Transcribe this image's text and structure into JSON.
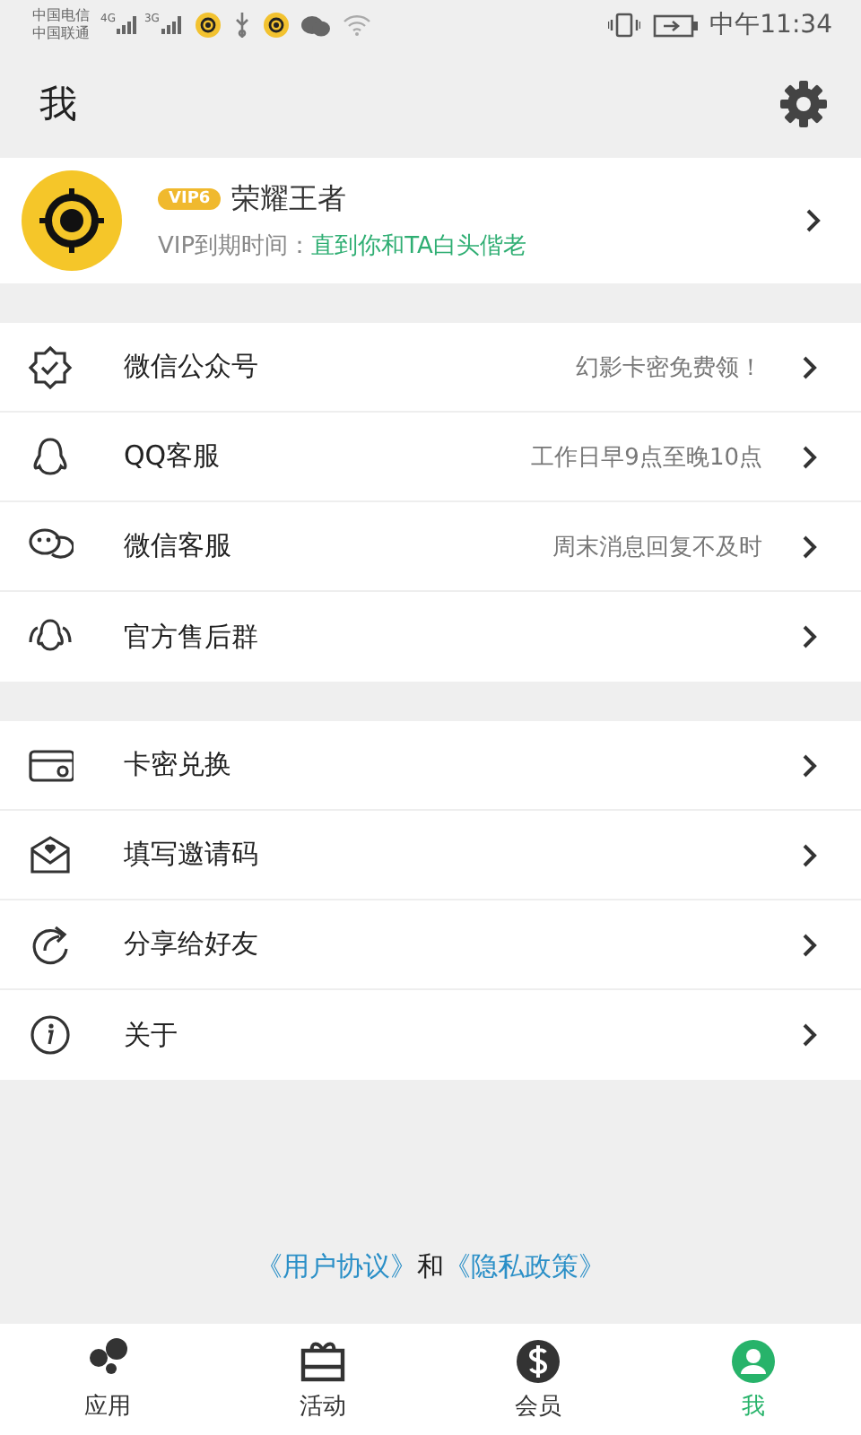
{
  "status_bar": {
    "carriers": [
      "中国电信",
      "中国联通"
    ],
    "networks": [
      "4G",
      "3G"
    ],
    "time": "中午11:34"
  },
  "header": {
    "title": "我"
  },
  "profile": {
    "badge": "VIP6",
    "name": "荣耀王者",
    "expiry_label": "VIP到期时间：",
    "expiry_value": "直到你和TA白头偕老"
  },
  "groups": [
    [
      {
        "label": "微信公众号",
        "note": "幻影卡密免费领！"
      },
      {
        "label": "QQ客服",
        "note": "工作日早9点至晚10点"
      },
      {
        "label": "微信客服",
        "note": "周末消息回复不及时"
      },
      {
        "label": "官方售后群"
      }
    ],
    [
      {
        "label": "卡密兑换"
      },
      {
        "label": "填写邀请码"
      },
      {
        "label": "分享给好友"
      },
      {
        "label": "关于"
      }
    ]
  ],
  "agreement": {
    "link1": "《用户协议》",
    "joiner": "和",
    "link2": "《隐私政策》"
  },
  "tabs": [
    {
      "label": "应用",
      "selected": false
    },
    {
      "label": "活动",
      "selected": false
    },
    {
      "label": "会员",
      "selected": false
    },
    {
      "label": "我",
      "selected": true
    }
  ]
}
